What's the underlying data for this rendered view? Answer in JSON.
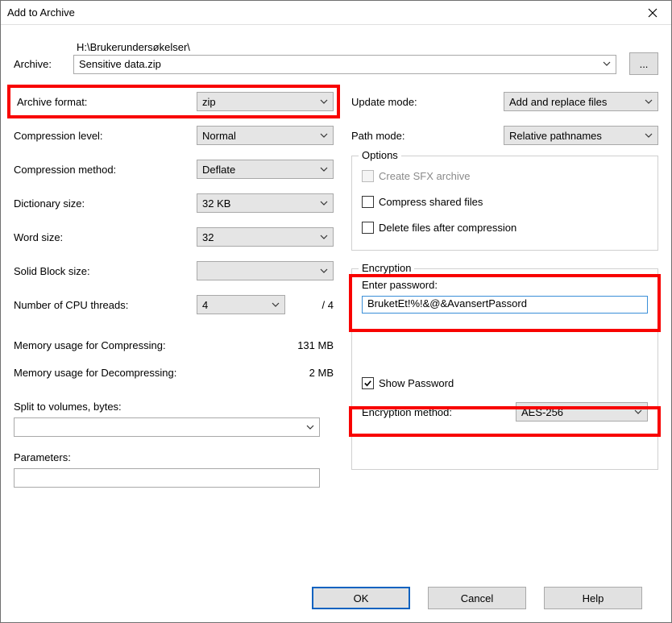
{
  "title": "Add to Archive",
  "archive": {
    "label": "Archive:",
    "path": "H:\\Brukerundersøkelser\\",
    "filename": "Sensitive data.zip",
    "browse": "..."
  },
  "left": {
    "archive_format": {
      "label": "Archive format:",
      "value": "zip"
    },
    "compression_level": {
      "label": "Compression level:",
      "value": "Normal"
    },
    "compression_method": {
      "label": "Compression method:",
      "value": "Deflate"
    },
    "dictionary_size": {
      "label": "Dictionary size:",
      "value": "32 KB"
    },
    "word_size": {
      "label": "Word size:",
      "value": "32"
    },
    "solid_block_size": {
      "label": "Solid Block size:",
      "value": ""
    },
    "cpu_threads": {
      "label": "Number of CPU threads:",
      "value": "4",
      "total": "/ 4"
    },
    "mem_compress": {
      "label": "Memory usage for Compressing:",
      "value": "131 MB"
    },
    "mem_decompress": {
      "label": "Memory usage for Decompressing:",
      "value": "2 MB"
    },
    "split_volumes": {
      "label": "Split to volumes, bytes:",
      "value": ""
    },
    "parameters": {
      "label": "Parameters:",
      "value": ""
    }
  },
  "right": {
    "update_mode": {
      "label": "Update mode:",
      "value": "Add and replace files"
    },
    "path_mode": {
      "label": "Path mode:",
      "value": "Relative pathnames"
    },
    "options": {
      "legend": "Options",
      "sfx": "Create SFX archive",
      "shared": "Compress shared files",
      "delete": "Delete files after compression"
    },
    "encryption": {
      "legend": "Encryption",
      "enter_pw": "Enter password:",
      "pw_value": "BruketEt!%!&@&AvansertPassord",
      "show_pw": "Show Password",
      "method_label": "Encryption method:",
      "method_value": "AES-256"
    }
  },
  "buttons": {
    "ok": "OK",
    "cancel": "Cancel",
    "help": "Help"
  }
}
